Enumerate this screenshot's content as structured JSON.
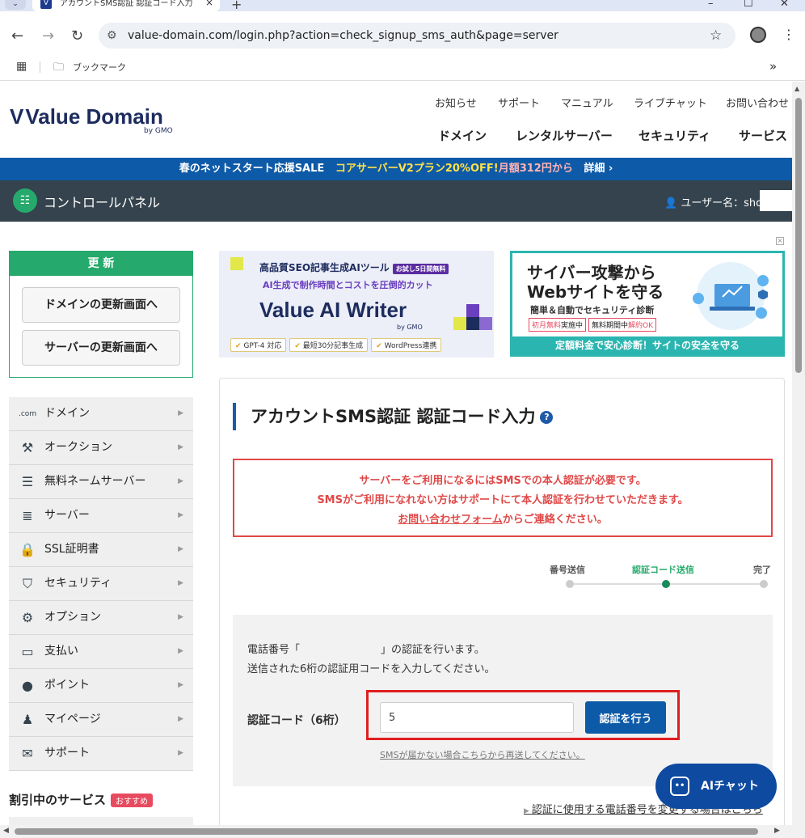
{
  "browser": {
    "tab_title": "アカウントSMS認証 認証コード入力",
    "tab_favicon": "V",
    "url": "value-domain.com/login.php?action=check_signup_sms_auth&page=server",
    "bookmarks_label": "ブックマーク",
    "icons": [
      "back-icon",
      "forward-icon",
      "reload-icon",
      "site-info-icon",
      "star-icon",
      "profile-icon",
      "menu-icon",
      "apps-icon",
      "folder-icon"
    ]
  },
  "header": {
    "logo_text": "Value Domain",
    "logo_sub": "by GMO",
    "util_nav": [
      "お知らせ",
      "サポート",
      "マニュアル",
      "ライブチャット",
      "お問い合わせ"
    ],
    "main_nav": [
      "ドメイン",
      "レンタルサーバー",
      "セキュリティ",
      "サービス"
    ]
  },
  "banner": {
    "part1": "春のネットスタート応援SALE",
    "part2": "コアサーバーV2プラン20%OFF!",
    "part3": "月額312円から",
    "part4": "詳細 ›"
  },
  "control_panel": {
    "title": "コントロールパネル",
    "user_label": "ユーザー名：sho"
  },
  "renew": {
    "title": "更 新",
    "domain_button": "ドメインの更新画面へ",
    "server_button": "サーバーの更新画面へ"
  },
  "menu": [
    {
      "label": "ドメイン",
      "icon": "com-icon"
    },
    {
      "label": "オークション",
      "icon": "gavel-icon"
    },
    {
      "label": "無料ネームサーバー",
      "icon": "nameserver-icon"
    },
    {
      "label": "サーバー",
      "icon": "server-icon"
    },
    {
      "label": "SSL証明書",
      "icon": "lock-icon"
    },
    {
      "label": "セキュリティ",
      "icon": "shield-icon"
    },
    {
      "label": "オプション",
      "icon": "gears-icon"
    },
    {
      "label": "支払い",
      "icon": "card-icon"
    },
    {
      "label": "ポイント",
      "icon": "piggy-bank-icon"
    },
    {
      "label": "マイページ",
      "icon": "person-icon"
    },
    {
      "label": "サポート",
      "icon": "mail-icon"
    }
  ],
  "discount": {
    "title": "割引中のサービス",
    "badge": "おすすめ"
  },
  "ad1": {
    "line1": "高品質SEO記事生成AIツール",
    "tag": "お試し5日間無料",
    "line2": "AI生成で制作時間とコストを圧倒的カット",
    "logo": "Value AI Writer",
    "logo_sub": "by GMO",
    "chips": [
      "GPT-4 対応",
      "最短30分記事生成",
      "WordPress連携"
    ]
  },
  "ad2": {
    "line1": "サイバー攻撃から",
    "line2": "Webサイトを守る",
    "line3": "簡単＆自動でセキュリティ診断",
    "tag1_a": "初月無料",
    "tag1_b": "実施中",
    "tag2_a": "無料期間中",
    "tag2_b": "解約OK",
    "footer": "定額料金で安心診断！サイトの安全を守る"
  },
  "main": {
    "title": "アカウントSMS認証 認証コード入力",
    "warning_line1": "サーバーをご利用になるにはSMSでの本人認証が必要です。",
    "warning_line2": "SMSがご利用になれない方はサポートにて本人認証を行わせていただきます。",
    "warning_link": "お問い合わせフォーム",
    "warning_line3_tail": "からご連絡ください。",
    "steps": [
      "番号送信",
      "認証コード送信",
      "完了"
    ],
    "active_step": 1,
    "instr_line1_a": "電話番号「",
    "instr_line1_b": "」の認証を行います。",
    "instr_line2": "送信された6桁の認証用コードを入力してください。",
    "code_label": "認証コード（6桁）",
    "code_value": "5",
    "submit_label": "認証を行う",
    "resend_link": "SMSが届かない場合こちらから再送してください。",
    "change_link": "認証に使用する電話番号を変更する場合はこちら"
  },
  "ai_chat": {
    "label": "AIチャット"
  },
  "colors": {
    "accent_green": "#26a96c",
    "brand_blue": "#0d5aa8",
    "warning_red": "#e04848",
    "cp_bar": "#34434d"
  }
}
